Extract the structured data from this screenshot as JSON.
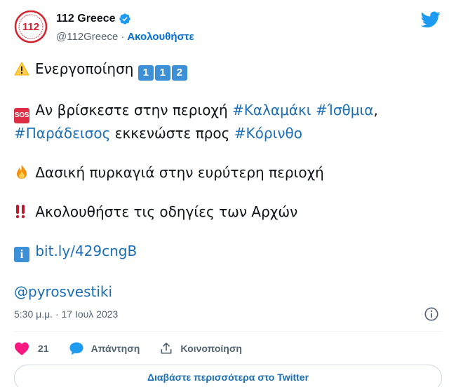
{
  "header": {
    "display_name": "112 Greece",
    "handle": "@112Greece",
    "separator": "·",
    "follow_label": "Ακολουθήστε",
    "avatar_text": "112"
  },
  "tweet": {
    "line1": {
      "text": "Ενεργοποίηση",
      "digits": [
        "1",
        "1",
        "2"
      ]
    },
    "line2": {
      "sos_label": "SOS",
      "prefix": "Αν βρίσκεστε στην περιοχή",
      "hashtag1": "#Καλαμάκι",
      "hashtag2": "#Ίσθμια",
      "comma": ","
    },
    "line3": {
      "hashtag3": "#Παράδεισος",
      "middle": "εκκενώστε προς",
      "hashtag4": "#Κόρινθο"
    },
    "line4": {
      "text": "Δασική πυρκαγιά στην ευρύτερη περιοχή"
    },
    "line5": {
      "text": "Ακολουθήστε τις οδηγίες των Αρχών"
    },
    "line6": {
      "info_label": "i",
      "link": "bit.ly/429cngB"
    },
    "line7": {
      "mention": "@pyrosvestiki"
    }
  },
  "meta": {
    "timestamp": "5:30 μ.μ. · 17 Ιουλ 2023"
  },
  "actions": {
    "like_count": "21",
    "reply_label": "Απάντηση",
    "share_label": "Κοινοποίηση"
  },
  "read_more_label": "Διαβάστε περισσότερα στο Twitter",
  "colors": {
    "accent": "#1d9bf0",
    "link": "#1b6fb8",
    "like": "#f91880",
    "muted": "#536471",
    "brand_red": "#d22630"
  }
}
